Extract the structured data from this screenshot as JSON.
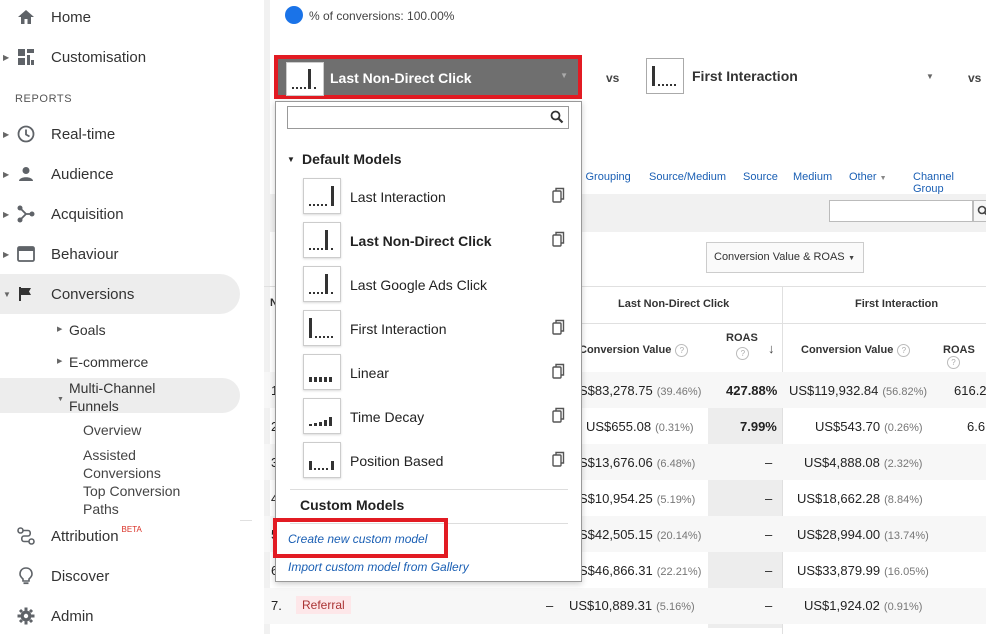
{
  "sidebar": {
    "home": "Home",
    "customisation": "Customisation",
    "reports_heading": "REPORTS",
    "realtime": "Real-time",
    "audience": "Audience",
    "acquisition": "Acquisition",
    "behaviour": "Behaviour",
    "conversions": "Conversions",
    "goals": "Goals",
    "ecommerce": "E-commerce",
    "mcf_line1": "Multi-Channel",
    "mcf_line2": "Funnels",
    "overview": "Overview",
    "assisted_line1": "Assisted",
    "assisted_line2": "Conversions",
    "top_line1": "Top Conversion",
    "top_line2": "Paths",
    "attribution": "Attribution",
    "beta": "BETA",
    "discover": "Discover",
    "admin": "Admin"
  },
  "header": {
    "conversions_pct": "% of conversions: 100.00%",
    "model1": "Last Non-Direct Click",
    "vs": "vs",
    "model2": "First Interaction"
  },
  "tabs": [
    "l Grouping",
    "Source/Medium",
    "Source",
    "Medium",
    "Other",
    "Channel Group"
  ],
  "metric_selector": "Conversion Value & ROAS",
  "table": {
    "group1": "Last Non-Direct Click",
    "group2": "First Interaction",
    "col_conv_value": "Conversion Value",
    "col_roas": "ROAS",
    "col_conv_value2": "Conversion Value",
    "col_roas2": "ROAS",
    "first_col_head": "N",
    "rows": [
      {
        "num": "1",
        "cv1": "S$83,278.75",
        "p1": "(39.46%)",
        "r1": "427.88%",
        "cv2": "US$119,932.84",
        "p2": "(56.82%)",
        "r2": "616.2"
      },
      {
        "num": "2",
        "cv1": "US$655.08",
        "p1": "(0.31%)",
        "r1": "7.99%",
        "cv2": "US$543.70",
        "p2": "(0.26%)",
        "r2": "6.6"
      },
      {
        "num": "3",
        "cv1": "S$13,676.06",
        "p1": "(6.48%)",
        "r1": "–",
        "cv2": "US$4,888.08",
        "p2": "(2.32%)",
        "r2": ""
      },
      {
        "num": "4",
        "cv1": "S$10,954.25",
        "p1": "(5.19%)",
        "r1": "–",
        "cv2": "US$18,662.28",
        "p2": "(8.84%)",
        "r2": ""
      },
      {
        "num": "5",
        "cv1": "S$42,505.15",
        "p1": "(20.14%)",
        "r1": "–",
        "cv2": "US$28,994.00",
        "p2": "(13.74%)",
        "r2": ""
      },
      {
        "num": "6",
        "cv1": "S$46,866.31",
        "p1": "(22.21%)",
        "r1": "–",
        "cv2": "US$33,879.99",
        "p2": "(16.05%)",
        "r2": ""
      },
      {
        "num": "7.",
        "channel": "Referral",
        "dash": "–",
        "cv1": "US$10,889.31",
        "p1": "(5.16%)",
        "r1": "–",
        "cv2": "US$1,924.02",
        "p2": "(0.91%)",
        "r2": ""
      }
    ]
  },
  "dropdown": {
    "search_placeholder": "",
    "default_heading": "Default Models",
    "items": [
      {
        "label": "Last Interaction"
      },
      {
        "label": "Last Non-Direct Click"
      },
      {
        "label": "Last Google Ads Click"
      },
      {
        "label": "First Interaction"
      },
      {
        "label": "Linear"
      },
      {
        "label": "Time Decay"
      },
      {
        "label": "Position Based"
      }
    ],
    "custom_heading": "Custom Models",
    "create_link": "Create new custom model",
    "import_link": "Import custom model from Gallery"
  },
  "colors": {
    "highlight": "#e21b23",
    "selector_bg": "#6f6f6f",
    "link": "#1a5fb4",
    "dot": "#1a73e8"
  }
}
